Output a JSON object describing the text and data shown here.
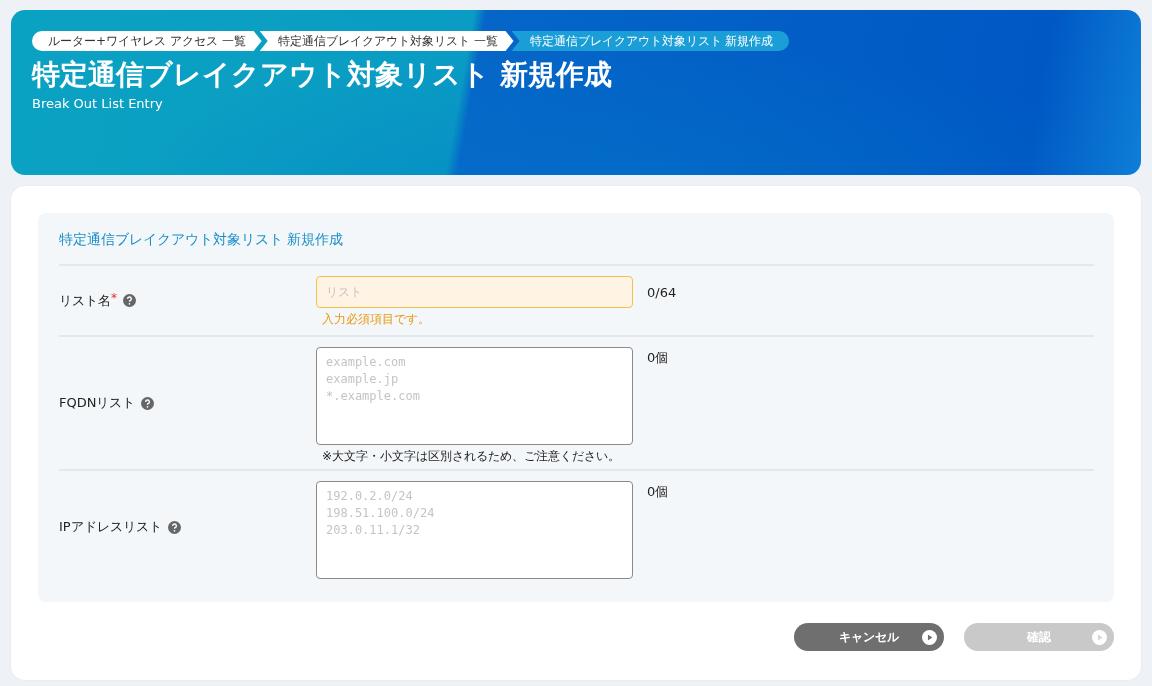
{
  "breadcrumbs": [
    {
      "label": "ルーター+ワイヤレス アクセス 一覧",
      "selected": false
    },
    {
      "label": "特定通信ブレイクアウト対象リスト 一覧",
      "selected": false
    },
    {
      "label": "特定通信ブレイクアウト対象リスト 新規作成",
      "selected": true
    }
  ],
  "page": {
    "title": "特定通信ブレイクアウト対象リスト 新規作成",
    "subtitle": "Break Out List Entry"
  },
  "form": {
    "title": "特定通信ブレイクアウト対象リスト 新規作成",
    "fields": [
      {
        "kind": "input",
        "label": "リスト名",
        "required": true,
        "required_mark": "*",
        "placeholder": "リスト",
        "error": true,
        "message": "入力必須項目です。",
        "counter": "0/64"
      },
      {
        "kind": "textarea",
        "label": "FQDNリスト",
        "required": false,
        "placeholder": "example.com\nexample.jp\n*.example.com",
        "error": false,
        "note": "※大文字・小文字は区別されるため、ご注意ください。",
        "counter": "0個"
      },
      {
        "kind": "textarea",
        "label": "IPアドレスリスト",
        "required": false,
        "placeholder": "192.0.2.0/24\n198.51.100.0/24\n203.0.11.1/32",
        "error": false,
        "counter": "0個"
      }
    ]
  },
  "buttons": [
    {
      "label": "キャンセル",
      "disabled": false
    },
    {
      "label": "確認",
      "disabled": true
    }
  ]
}
